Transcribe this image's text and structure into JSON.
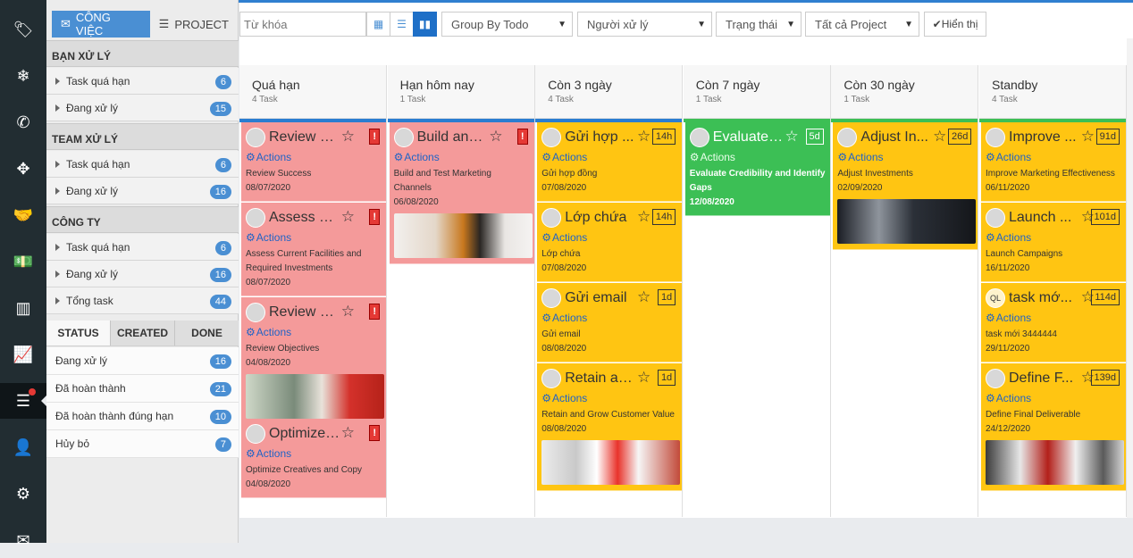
{
  "rail_icons": [
    "tag-icon",
    "snowflake-icon",
    "phone-icon",
    "crosshair-icon",
    "handshake-icon",
    "money-icon",
    "bar-chart-icon",
    "line-chart-icon",
    "list-icon",
    "user-icon",
    "gear-icon",
    "mail-icon"
  ],
  "side": {
    "tabs": [
      {
        "label": "CÔNG VIỆC"
      },
      {
        "label": "PROJECT"
      }
    ],
    "sections": [
      {
        "title": "BẠN XỬ LÝ",
        "items": [
          {
            "label": "Task quá hạn",
            "count": "6"
          },
          {
            "label": "Đang xử lý",
            "count": "15"
          }
        ]
      },
      {
        "title": "TEAM XỬ LÝ",
        "items": [
          {
            "label": "Task quá hạn",
            "count": "6"
          },
          {
            "label": "Đang xử lý",
            "count": "16"
          }
        ]
      },
      {
        "title": "CÔNG TY",
        "items": [
          {
            "label": "Task quá hạn",
            "count": "6"
          },
          {
            "label": "Đang xử lý",
            "count": "16"
          },
          {
            "label": "Tổng task",
            "count": "44"
          }
        ]
      }
    ],
    "status_tabs": [
      "STATUS",
      "CREATED",
      "DONE"
    ],
    "status_items": [
      {
        "label": "Đang xử lý",
        "count": "16"
      },
      {
        "label": "Đã hoàn thành",
        "count": "21"
      },
      {
        "label": "Đã hoàn thành đúng hạn",
        "count": "10"
      },
      {
        "label": "Hủy bỏ",
        "count": "7"
      }
    ]
  },
  "toolbar": {
    "keyword_placeholder": "Từ khóa",
    "group": "Group By Todo",
    "handler": "Người xử lý",
    "status": "Trạng thái",
    "project": "Tất cả Project",
    "show": "Hiển thị"
  },
  "columns": [
    {
      "title": "Quá hạn",
      "count": "4 Task",
      "bar": "#2a7dd1",
      "cards": [
        {
          "title": "Review S...",
          "tag": "!",
          "actions": "Actions",
          "desc": "Review Success",
          "date": "08/07/2020",
          "color": "red"
        },
        {
          "title": "Assess C...",
          "tag": "!",
          "actions": "Actions",
          "desc": "Assess Current Facilities and Required Investments",
          "date": "08/07/2020",
          "color": "red"
        },
        {
          "title": "Review O...",
          "tag": "!",
          "actions": "Actions",
          "desc": "Review Objectives",
          "date": "04/08/2020",
          "color": "red",
          "img": "photo-woman-laptop"
        },
        {
          "title": "Optimize ...",
          "tag": "!",
          "actions": "Actions",
          "desc": "Optimize Creatives and Copy",
          "date": "04/08/2020",
          "color": "red"
        }
      ]
    },
    {
      "title": "Hạn hôm nay",
      "count": "1 Task",
      "bar": "#2a7dd1",
      "cards": [
        {
          "title": "Build and ...",
          "tag": "!",
          "actions": "Actions",
          "desc": "Build and Test Marketing Channels",
          "date": "06/08/2020",
          "color": "red",
          "img": "photo-headphones"
        }
      ]
    },
    {
      "title": "Còn 3 ngày",
      "count": "4 Task",
      "bar": "#2a7dd1",
      "cards": [
        {
          "title": "Gửi hợp ...",
          "tag": "14h",
          "actions": "Actions",
          "desc": "Gửi hợp đồng",
          "date": "07/08/2020",
          "color": "yel"
        },
        {
          "title": "Lớp chứa",
          "tag": "14h",
          "actions": "Actions",
          "desc": "Lớp chứa",
          "date": "07/08/2020",
          "color": "yel"
        },
        {
          "title": "Gửi email",
          "tag": "1d",
          "actions": "Actions",
          "desc": "Gửi email",
          "date": "08/08/2020",
          "color": "yel"
        },
        {
          "title": "Retain an...",
          "tag": "1d",
          "actions": "Actions",
          "desc": "Retain and Grow Customer Value",
          "date": "08/08/2020",
          "color": "yel",
          "img": "photo-icare-center"
        }
      ]
    },
    {
      "title": "Còn 7 ngày",
      "count": "1 Task",
      "bar": "#3cbf55",
      "cards": [
        {
          "title": "Evaluate ...",
          "tag": "5d",
          "actions": "Actions",
          "desc": "Evaluate Credibility and Identify Gaps",
          "date": "12/08/2020",
          "color": "grn"
        }
      ]
    },
    {
      "title": "Còn 30 ngày",
      "count": "1 Task",
      "bar": "#3cbf55",
      "cards": [
        {
          "title": "Adjust In...",
          "tag": "26d",
          "actions": "Actions",
          "desc": "Adjust Investments",
          "date": "02/09/2020",
          "color": "yel",
          "img": "photo-ryzen-cpu"
        }
      ]
    },
    {
      "title": "Standby",
      "count": "4 Task",
      "bar": "#3cbf55",
      "cards": [
        {
          "title": "Improve ...",
          "tag": "91d",
          "actions": "Actions",
          "desc": "Improve Marketing Effectiveness",
          "date": "06/11/2020",
          "color": "yel"
        },
        {
          "title": "Launch ...",
          "tag": "101d",
          "actions": "Actions",
          "desc": "Launch Campaigns",
          "date": "16/11/2020",
          "color": "yel"
        },
        {
          "title": "task mớ...",
          "tag": "114d",
          "actions": "Actions",
          "desc": "task mới 3444444",
          "date": "29/11/2020",
          "color": "yel",
          "avatar": "QL"
        },
        {
          "title": "Define F...",
          "tag": "139d",
          "actions": "Actions",
          "desc": "Define Final Deliverable",
          "date": "24/12/2020",
          "color": "yel",
          "img": "photo-meeting"
        }
      ]
    }
  ]
}
